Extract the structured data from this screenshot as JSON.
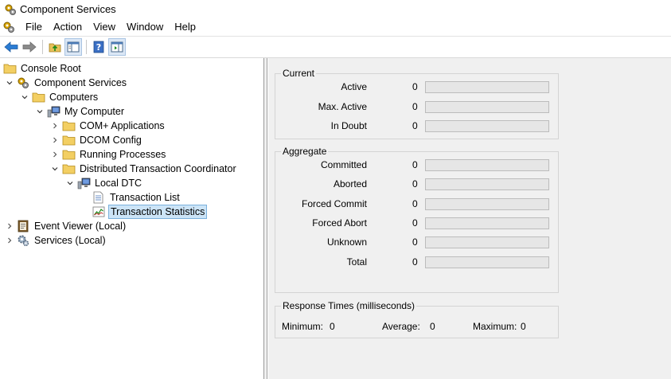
{
  "window": {
    "title": "Component Services"
  },
  "menu": [
    "File",
    "Action",
    "View",
    "Window",
    "Help"
  ],
  "toolbar": {
    "buttons": [
      "back-icon",
      "forward-icon",
      "up-folder-icon",
      "show-hide-console-tree-icon",
      "help-icon",
      "show-action-pane-icon"
    ]
  },
  "tree": {
    "items": [
      {
        "label": "Console Root",
        "icon": "folder-icon",
        "expanded": true
      },
      {
        "label": "Component Services",
        "icon": "component-services-icon",
        "expanded": true
      },
      {
        "label": "Computers",
        "icon": "folder-icon",
        "expanded": true
      },
      {
        "label": "My Computer",
        "icon": "computer-icon",
        "expanded": true
      },
      {
        "label": "COM+ Applications",
        "icon": "folder-icon",
        "expanded": false
      },
      {
        "label": "DCOM Config",
        "icon": "folder-icon",
        "expanded": false
      },
      {
        "label": "Running Processes",
        "icon": "folder-icon",
        "expanded": false
      },
      {
        "label": "Distributed Transaction Coordinator",
        "icon": "folder-icon",
        "expanded": true
      },
      {
        "label": "Local DTC",
        "icon": "computer-icon",
        "expanded": true
      },
      {
        "label": "Transaction List",
        "icon": "list-icon",
        "expanded": false
      },
      {
        "label": "Transaction Statistics",
        "icon": "chart-icon",
        "expanded": false,
        "selected": true
      },
      {
        "label": "Event Viewer (Local)",
        "icon": "event-viewer-icon",
        "expanded": false
      },
      {
        "label": "Services (Local)",
        "icon": "gear-icon",
        "expanded": false
      }
    ]
  },
  "stats": {
    "current": {
      "title": "Current",
      "rows": [
        {
          "label": "Active",
          "value": "0",
          "fill": 0
        },
        {
          "label": "Max. Active",
          "value": "0",
          "fill": 0
        },
        {
          "label": "In Doubt",
          "value": "0",
          "fill": 0
        }
      ]
    },
    "aggregate": {
      "title": "Aggregate",
      "rows": [
        {
          "label": "Committed",
          "value": "0",
          "fill": 0
        },
        {
          "label": "Aborted",
          "value": "0",
          "fill": 0
        },
        {
          "label": "Forced Commit",
          "value": "0",
          "fill": 0
        },
        {
          "label": "Forced Abort",
          "value": "0",
          "fill": 0
        },
        {
          "label": "Unknown",
          "value": "0",
          "fill": 0
        },
        {
          "label": "Total",
          "value": "0",
          "fill": 0
        }
      ]
    },
    "response": {
      "title": "Response Times (milliseconds)",
      "minimum_label": "Minimum:",
      "minimum": "0",
      "average_label": "Average:",
      "average": "0",
      "maximum_label": "Maximum:",
      "maximum": "0"
    }
  },
  "colors": {
    "selection": "#cce4f7",
    "selection_border": "#7ab0dc",
    "panel_bg": "#f0f0f0",
    "bar_fill": "#06b025"
  }
}
